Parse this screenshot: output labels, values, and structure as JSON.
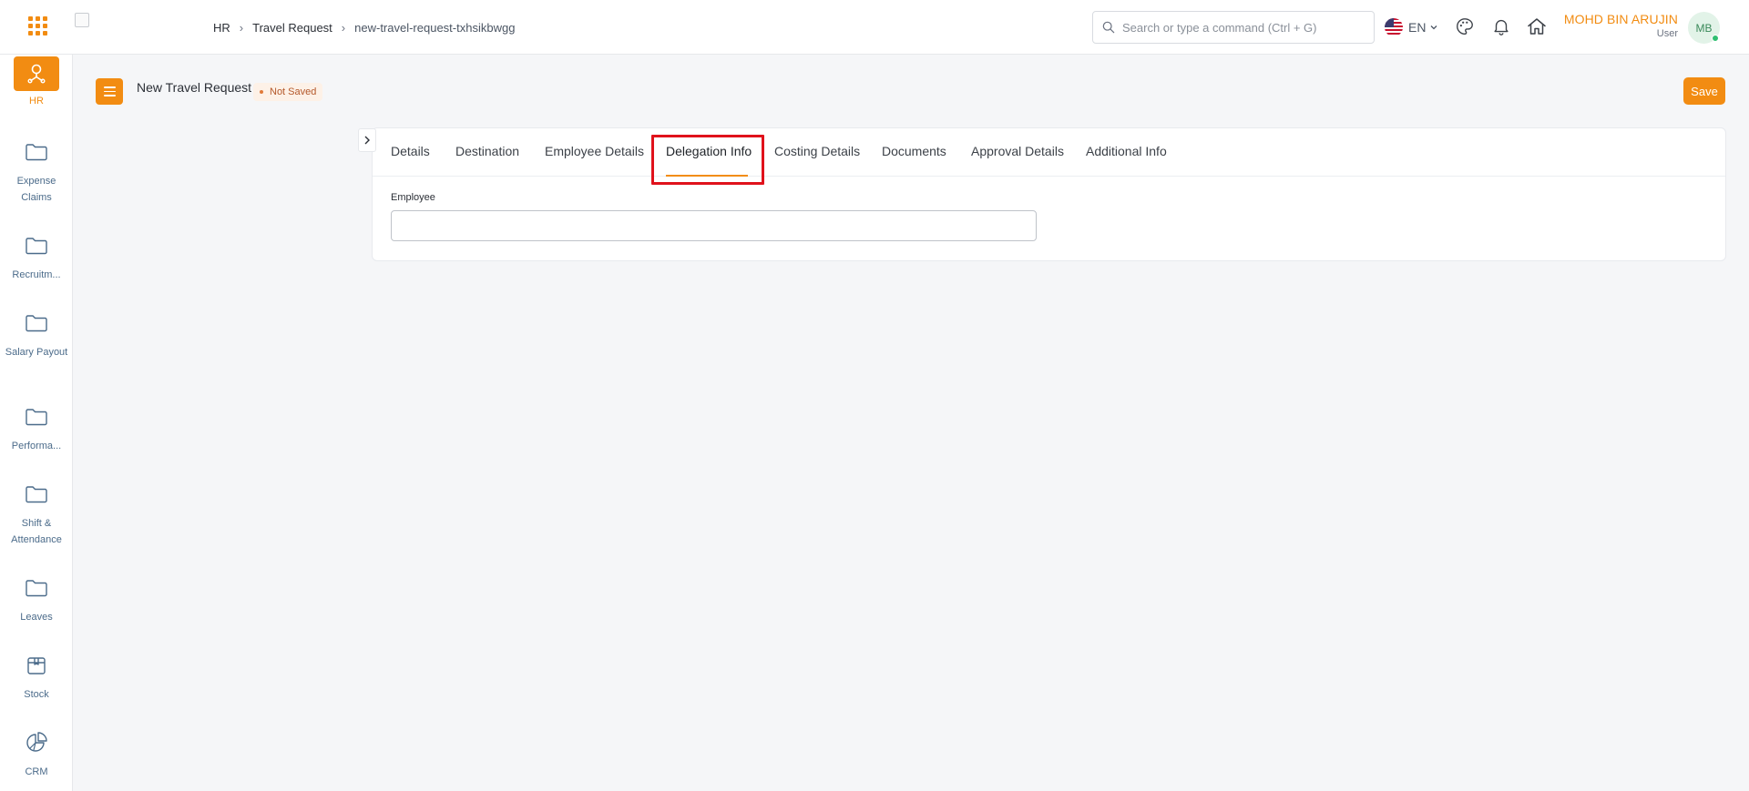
{
  "header": {
    "breadcrumb": [
      "HR",
      "Travel Request",
      "new-travel-request-txhsikbwgg"
    ],
    "search_placeholder": "Search or type a command (Ctrl + G)",
    "language": "EN",
    "user": {
      "name": "MOHD BIN ARUJIN",
      "role": "User",
      "initials": "MB"
    }
  },
  "sidebar": {
    "items": [
      {
        "label": "HR",
        "icon": "hr-org-icon",
        "active": true
      },
      {
        "label": "Expense Claims",
        "icon": "folder-icon"
      },
      {
        "label": "Recruitm...",
        "icon": "folder-icon"
      },
      {
        "label": "Salary Payout",
        "icon": "folder-icon"
      },
      {
        "label": "Performa...",
        "icon": "folder-icon"
      },
      {
        "label": "Shift & Attendance",
        "icon": "folder-icon"
      },
      {
        "label": "Leaves",
        "icon": "folder-icon"
      },
      {
        "label": "Stock",
        "icon": "box-icon"
      },
      {
        "label": "CRM",
        "icon": "pie-chart-icon"
      }
    ]
  },
  "page": {
    "title": "New Travel Request",
    "status": "Not Saved",
    "save_label": "Save"
  },
  "form": {
    "tabs": [
      "Details",
      "Destination",
      "Employee Details",
      "Delegation Info",
      "Costing Details",
      "Documents",
      "Approval Details",
      "Additional Info"
    ],
    "active_tab": "Delegation Info",
    "employee_label": "Employee",
    "employee_value": ""
  },
  "colors": {
    "accent": "#f28c12",
    "highlight": "#e0121b",
    "sidebar_label": "#4b6b8a"
  }
}
